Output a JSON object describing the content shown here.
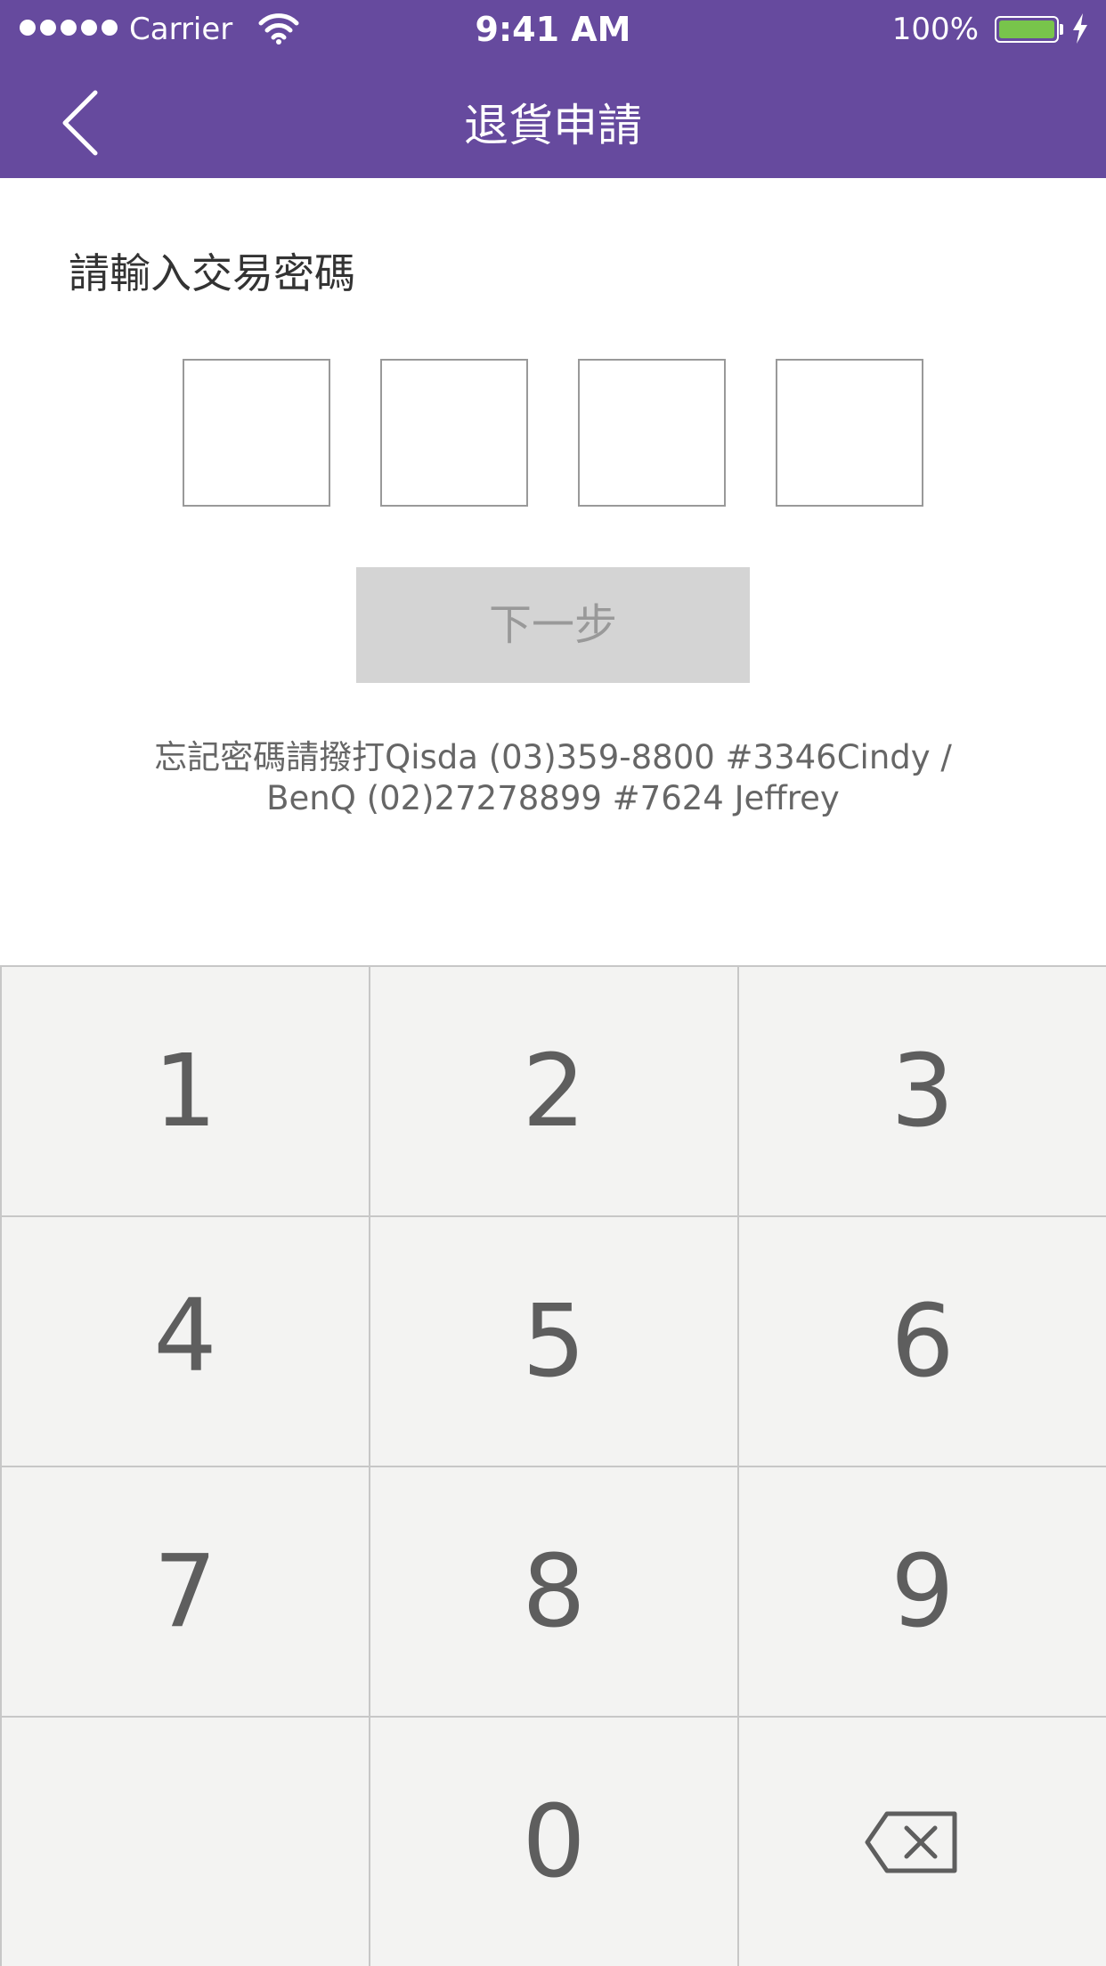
{
  "status_bar": {
    "carrier": "Carrier",
    "time": "9:41 AM",
    "battery_percent": "100%",
    "battery_level": 1.0,
    "icons": [
      "signal-dots-icon",
      "wifi-icon",
      "battery-icon",
      "charging-bolt-icon"
    ]
  },
  "nav": {
    "title": "退貨申請",
    "back_icon": "chevron-left-icon"
  },
  "content": {
    "prompt": "請輸入交易密碼",
    "pin_digits": [
      "",
      "",
      "",
      ""
    ],
    "next_label": "下一步",
    "help_line1": "忘記密碼請撥打Qisda (03)359-8800 #3346Cindy /",
    "help_line2": "BenQ (02)27278899 #7624 Jeffrey"
  },
  "keypad": {
    "keys": [
      "1",
      "2",
      "3",
      "4",
      "5",
      "6",
      "7",
      "8",
      "9",
      "",
      "0",
      ""
    ],
    "backspace_icon": "backspace-icon"
  },
  "colors": {
    "header_bg": "#664A9E",
    "button_disabled_bg": "#D4D4D4",
    "keypad_bg": "#F3F3F2",
    "battery_fill": "#78C44B"
  }
}
